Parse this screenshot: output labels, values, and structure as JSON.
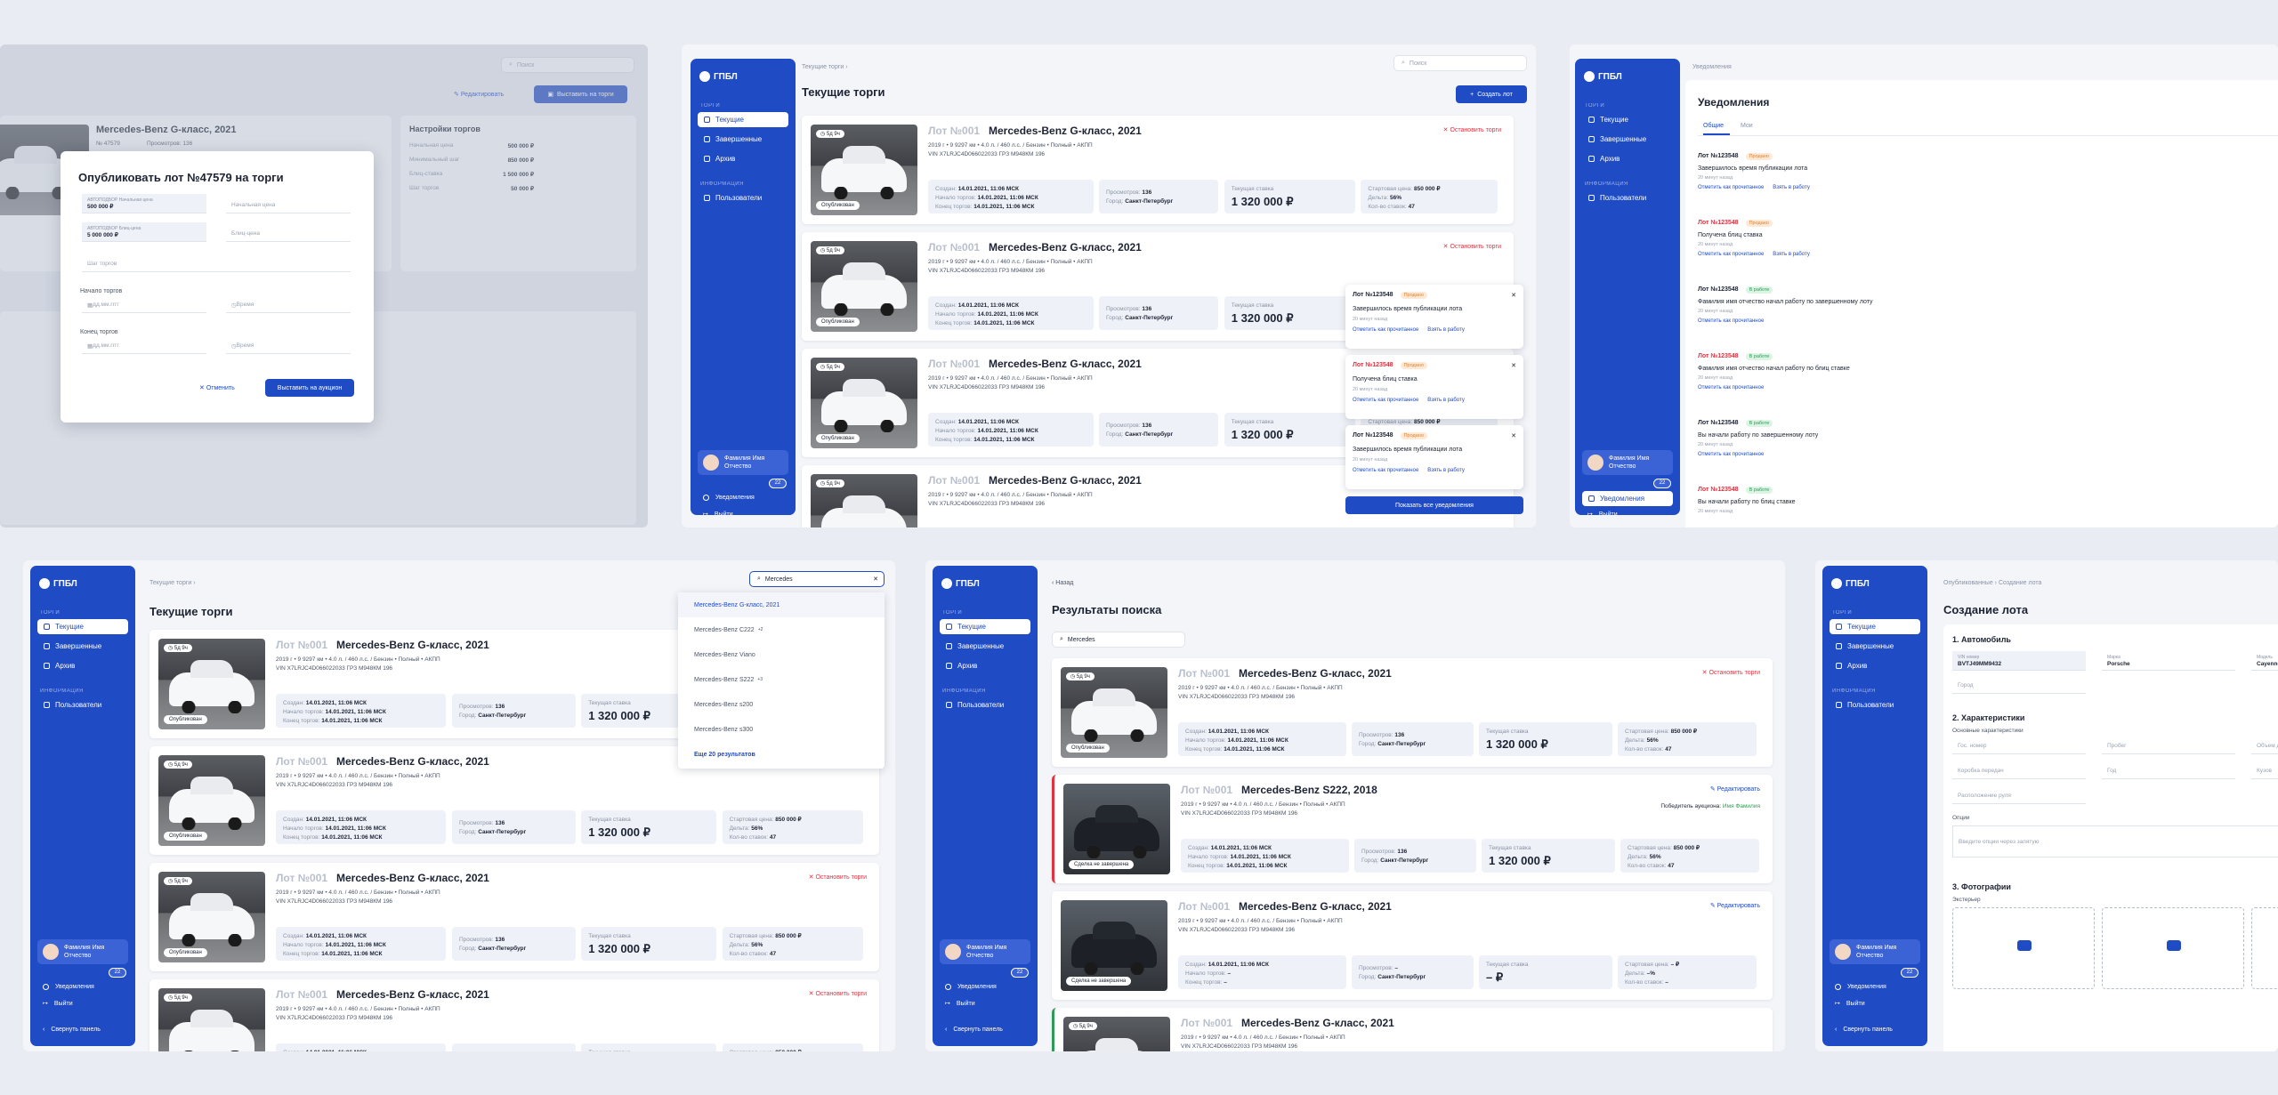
{
  "brand": {
    "logo": "ГПБЛ",
    "accent": "#1f4bc4",
    "danger": "#e0323f",
    "success": "#2f9b57"
  },
  "sidebar": {
    "sec_trades": "ТОРГИ",
    "sec_info": "ИНФОРМАЦИЯ",
    "items": [
      "Текущие",
      "Завершенные",
      "Архив"
    ],
    "info_items": [
      "Пользователи"
    ],
    "user": "Фамилия Имя Отчество",
    "badge": "22",
    "notifications": "Уведомления",
    "logout": "Выйти",
    "collapse": "Свернуть панель"
  },
  "lot": {
    "num": "Лот №001",
    "model": "Mercedes-Benz G-класс, 2021",
    "model2": "Mercedes-Benz S222, 2018",
    "specs": "2019 г  •  9 9297 км  •  4.0 л. / 460 л.с. / Бензин  •  Полный  •  АКПП",
    "vin": "VIN  X7LRJC4D066022033   ГРЗ  М948КМ 196",
    "time_chip": "5д 9ч",
    "published": "Опубликован",
    "completed": "Сделка не завершена",
    "created_lbl": "Создан:",
    "start_lbl": "Начало торгов:",
    "end_lbl": "Конец торгов:",
    "date": "14.01.2021, 11:06 МСК",
    "views_lbl": "Просмотров:",
    "views": "136",
    "city_lbl": "Город:",
    "city": "Санкт-Петербург",
    "cur_lbl": "Текущая ставка",
    "cur": "1 320 000 ₽",
    "start_price_lbl": "Стартовая цена:",
    "start_price": "850 000 ₽",
    "delta_lbl": "Дельта:",
    "delta": "56%",
    "bids_lbl": "Кол-во ставок:",
    "bids": "47",
    "stop": "Остановить торги",
    "edit": "Редактировать",
    "winner_lbl": "Победитель аукциона:",
    "winner": "Имя Фамилия",
    "dash": "–",
    "dash_price": "– ₽",
    "dash_pct": "–%"
  },
  "p1": {
    "publish_edit": "Редактировать",
    "publish_btn": "Выставить на торги",
    "search": "Поиск",
    "head_model": "Mercedes-Benz G-класс, 2021",
    "head_lot": "№ 47579",
    "head_views": "Просмотров: 136",
    "settings": "Настройки торгов",
    "set_rows": [
      [
        "Начальная цена",
        "500 000 ₽"
      ],
      [
        "Минимальный шаг",
        "850 000 ₽"
      ],
      [
        "Блиц-ставка",
        "1 500 000 ₽"
      ],
      [
        "Шаг торгов",
        "50 000 ₽"
      ]
    ],
    "modal": {
      "title": "Опубликовать лот №47579 на торги",
      "auto_start_lbl": "АВТОПОДБОР Начальная цена",
      "auto_start": "500 000 ₽",
      "start_ph": "Начальная цена",
      "auto_blitz_lbl": "АВТОПОДБОР Блиц-цена",
      "auto_blitz": "5 000 000 ₽",
      "blitz_ph": "Блиц-цена",
      "step_ph": "Шаг торгов",
      "start_lbl": "Начало торгов",
      "end_lbl": "Конец торгов",
      "date_ph": "дд.мм.гггг",
      "time_ph": "Время",
      "cancel": "Отменить",
      "submit": "Выставить на аукцион"
    }
  },
  "p2": {
    "crumb": "Текущие торги  ›",
    "title": "Текущие торги",
    "search": "Поиск",
    "create": "Создать лот",
    "show_all": "Показать все уведомления"
  },
  "notifs": [
    {
      "lot": "Лот №123548",
      "tag": "Продано",
      "tagc": "o",
      "text": "Завершилось время публикации лота",
      "ago": "20 минут назад",
      "a1": "Отметить как прочитанное",
      "a2": "Взять в работу",
      "red": false
    },
    {
      "lot": "Лот №123548",
      "tag": "Продано",
      "tagc": "o",
      "text": "Получена блиц ставка",
      "ago": "20 минут назад",
      "a1": "Отметить как прочитанное",
      "a2": "Взять в работу",
      "red": true
    },
    {
      "lot": "Лот №123548",
      "tag": "В работе",
      "tagc": "g",
      "text": "Фамилия имя отчество начал работу по завершенному лоту",
      "ago": "20 минут назад",
      "a1": "Отметить как прочитанное",
      "a2": "",
      "red": false
    },
    {
      "lot": "Лот №123548",
      "tag": "В работе",
      "tagc": "g",
      "text": "Фамилия имя отчество начал работу по блиц ставке",
      "ago": "20 минут назад",
      "a1": "Отметить как прочитанное",
      "a2": "",
      "red": true
    },
    {
      "lot": "Лот №123548",
      "tag": "В работе",
      "tagc": "g",
      "text": "Вы начали работу по завершенному лоту",
      "ago": "20 минут назад",
      "a1": "Отметить как прочитанное",
      "a2": "",
      "red": false
    },
    {
      "lot": "Лот №123548",
      "tag": "В работе",
      "tagc": "g",
      "text": "Вы начали работу по блиц ставке",
      "ago": "20 минут назад",
      "a1": "",
      "a2": "",
      "red": true
    }
  ],
  "p3": {
    "crumb": "Уведомления",
    "title": "Уведомления",
    "tab1": "Общие",
    "tab2": "Мои"
  },
  "p4": {
    "crumb": "Текущие торги  ›",
    "title": "Текущие торги",
    "query": "Mercedes",
    "suggest": [
      "Mercedes-Benz G-класс, 2021",
      "Mercedes-Benz C222",
      "Mercedes-Benz Viano",
      "Mercedes-Benz S222",
      "Mercedes-Benz s200",
      "Mercedes-Benz s300"
    ],
    "sup1": "+2",
    "sup2": "+3",
    "more": "Еще 20 результатов"
  },
  "p5": {
    "back": "‹  Назад",
    "title": "Результаты поиска",
    "query": "Mercedes"
  },
  "p6": {
    "crumb": "Опубликованные  ›  Создание лота",
    "title": "Создание лота",
    "s1": "1. Автомобиль",
    "vin_lbl": "VIN номер",
    "vin": "BVTJ49MM9432",
    "brand": "Porsche",
    "model": "Cayenne",
    "city_ph": "Город",
    "s2": "2. Характеристики",
    "sub": "Основные характеристики",
    "f1": "Гос. номер",
    "f2": "Пробег",
    "f3": "Объем двигателя",
    "f4": "Коробка передач",
    "f5": "Год",
    "f6": "Кузов",
    "f7": "Расположение руля",
    "opts": "Опции",
    "opts_ph": "Введите опции через запятую",
    "s3": "3. Фотографии",
    "ext": "Экстерьер",
    "brand_lbl": "Марка",
    "model_lbl": "Модель"
  }
}
